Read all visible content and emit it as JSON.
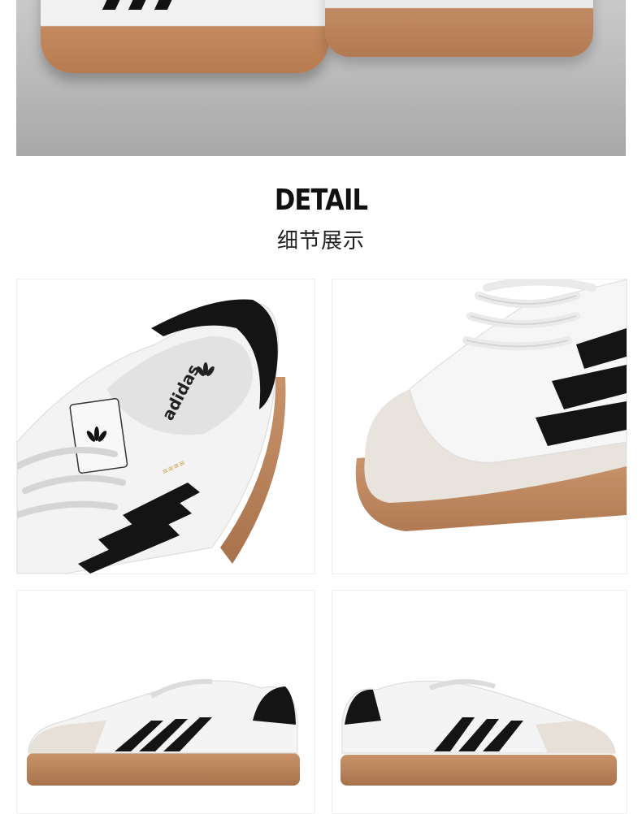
{
  "section": {
    "title_en": "DETAIL",
    "title_cn": "细节展示"
  },
  "brand": {
    "wordmark": "adidas"
  },
  "images": [
    {
      "name": "hero-shoe-photo"
    },
    {
      "name": "detail-tongue-photo"
    },
    {
      "name": "detail-toe-photo"
    },
    {
      "name": "side-view-left-photo"
    },
    {
      "name": "side-view-right-photo"
    }
  ],
  "colors": {
    "leather": "#f4f4f4",
    "stripe": "#111111",
    "gum_sole": "#c48a5f",
    "suede": "#e7e1da"
  }
}
